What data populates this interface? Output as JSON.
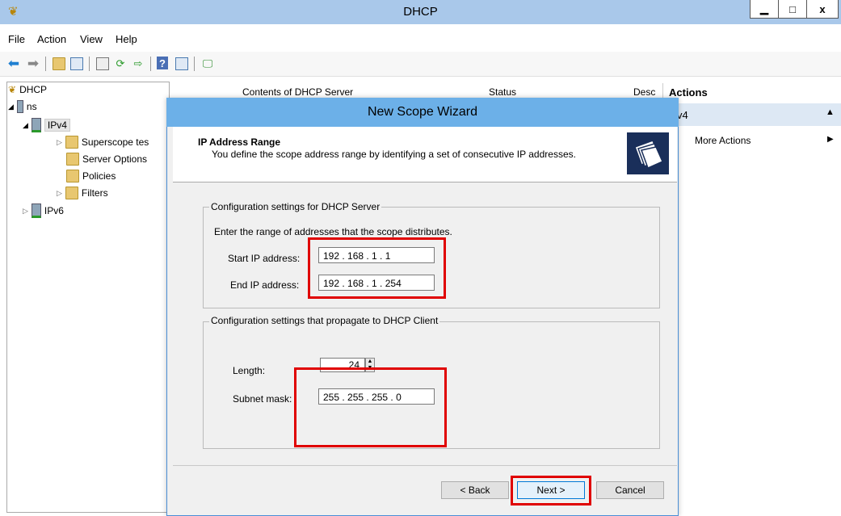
{
  "window": {
    "title": "DHCP",
    "minimize_glyph": "▁",
    "maximize_glyph": "□",
    "close_glyph": "x",
    "app_icon_name": "dhcp-icon"
  },
  "menu": {
    "items": [
      "File",
      "Action",
      "View",
      "Help"
    ]
  },
  "toolbar": {
    "icons": [
      "back-icon",
      "forward-icon",
      "up-folder-icon",
      "show-hide-tree-icon",
      "properties-icon",
      "refresh-icon",
      "export-list-icon",
      "help-icon",
      "show-hide-action-icon",
      "monitor-icon"
    ]
  },
  "tree": {
    "root": "DHCP",
    "server": "ns",
    "ipv4": "IPv4",
    "superscope": "Superscope tes",
    "server_options": "Server Options",
    "policies": "Policies",
    "filters": "Filters",
    "ipv6": "IPv6"
  },
  "list": {
    "columns": [
      "Contents of DHCP Server",
      "Status",
      "Desc"
    ]
  },
  "actions": {
    "header": "Actions",
    "section": "v4",
    "more_actions": "More Actions"
  },
  "wizard": {
    "title": "New Scope Wizard",
    "heading": "IP Address Range",
    "subheading": "You define the scope address range by identifying a set of consecutive IP addresses.",
    "server_group_label": "Configuration settings for DHCP Server",
    "range_instruction": "Enter the range of addresses that the scope distributes.",
    "start_label": "Start IP address:",
    "start_ip": "192 . 168 .  1  .  1",
    "end_label": "End IP address:",
    "end_ip": "192 . 168 .  1  . 254",
    "client_group_label": "Configuration settings that propagate to DHCP Client",
    "length_label": "Length:",
    "length_value": "24",
    "subnet_label": "Subnet mask:",
    "subnet_mask": "255 . 255 . 255 .  0",
    "back_button": "< Back",
    "next_button": "Next >",
    "cancel_button": "Cancel"
  },
  "colors": {
    "highlight_red": "#e00000",
    "titlebar": "#a9c8ea",
    "wizard_titlebar": "#6cb0e8"
  }
}
